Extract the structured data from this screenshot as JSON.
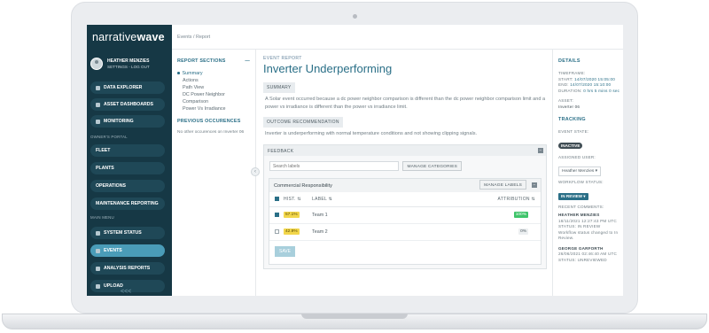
{
  "app": {
    "logo_left": "narrative",
    "logo_right": "wave"
  },
  "user": {
    "name": "HEATHER MENZIES",
    "links": "SETTINGS - LOG OUT"
  },
  "nav": {
    "data_explorer": "DATA EXPLORER",
    "asset_dashboards": "ASSET DASHBOARDS",
    "monitoring": "MONITORING",
    "owners_portal": "OWNER'S PORTAL",
    "fleet": "FLEET",
    "plants": "PLANTS",
    "operations": "OPERATIONS",
    "maintenance": "MAINTENANCE REPORTING",
    "main_menu": "MAIN MENU",
    "system_status": "SYSTEM STATUS",
    "events": "EVENTS",
    "analysis_reports": "ANALYSIS REPORTS",
    "upload": "UPLOAD",
    "collapse": "<<<"
  },
  "breadcrumb": "Events  /  Report",
  "report_sections": {
    "title": "REPORT SECTIONS",
    "items": [
      "Summary",
      "Actions",
      "Path View",
      "DC Power Neighbor Comparison",
      "Power Vs Irradiance"
    ],
    "prev_title": "PREVIOUS OCCURENCES",
    "prev_empty": "No other occurences on Inverter 06"
  },
  "event": {
    "label": "EVENT REPORT",
    "title": "Inverter Underperforming",
    "summary_tag": "SUMMARY",
    "summary_text": "A Solar event occurred because a dc power neighbor comparison is different than the dc power neighbor comparison limit and a power vs irradiance is different than the power vs irradiance limit.",
    "outcome_tag": "OUTCOME RECOMMENDATION",
    "outcome_text": "Inverter is underperforming with normal temperature conditions and not showing clipping signals."
  },
  "feedback": {
    "title": "FEEDBACK",
    "search_placeholder": "Search labels",
    "manage_categories": "MANAGE CATEGORIES",
    "category": "Commercial Responsibility",
    "manage_labels": "MANAGE LABELS",
    "col_hist": "HIST. ⇅",
    "col_label": "LABEL ⇅",
    "col_attr": "ATTRIBUTION ⇅",
    "rows": [
      {
        "hist": "57.1%",
        "label": "Team 1",
        "attr": "100%",
        "checked": true
      },
      {
        "hist": "42.9%",
        "label": "Team 2",
        "attr": "0%",
        "checked": false
      }
    ],
    "save": "SAVE"
  },
  "details": {
    "title": "DETAILS",
    "timeframe": "TIMEFRAME:",
    "start_k": "START:",
    "start_v": "14/07/2020 15:05:00",
    "end_k": "END:",
    "end_v": "14/07/2020 15:10:00",
    "dur_k": "DURATION:",
    "dur_v": "0 hrs 5 mins 0 sec",
    "asset_k": "ASSET:",
    "asset_v": "Inverter 06"
  },
  "tracking": {
    "title": "TRACKING",
    "event_state": "EVENT STATE:",
    "state": "INACTIVE",
    "assigned": "ASSIGNED USER:",
    "assigned_user": "Heather Menzies ▾",
    "workflow": "WORKFLOW STATUS:",
    "workflow_val": "IN REVIEW ▾",
    "recent": "RECENT COMMENTS:",
    "c1_name": "HEATHER MENZIES",
    "c1_date": "18/11/2021 12:27:43 PM UTC",
    "c1_status": "STATUS: IN REVIEW",
    "c1_text": "Workflow status changed to In Review.",
    "c2_name": "GEORGE GARFORTH",
    "c2_date": "26/06/2021 02:46:40 AM UTC",
    "c2_status": "STATUS: UNREVIEWED"
  },
  "colors": {
    "accent": "#2a6f87",
    "sidebar": "#163845",
    "active": "#4a9cb8",
    "green": "#3fc46a",
    "yellow": "#f2d64b"
  }
}
